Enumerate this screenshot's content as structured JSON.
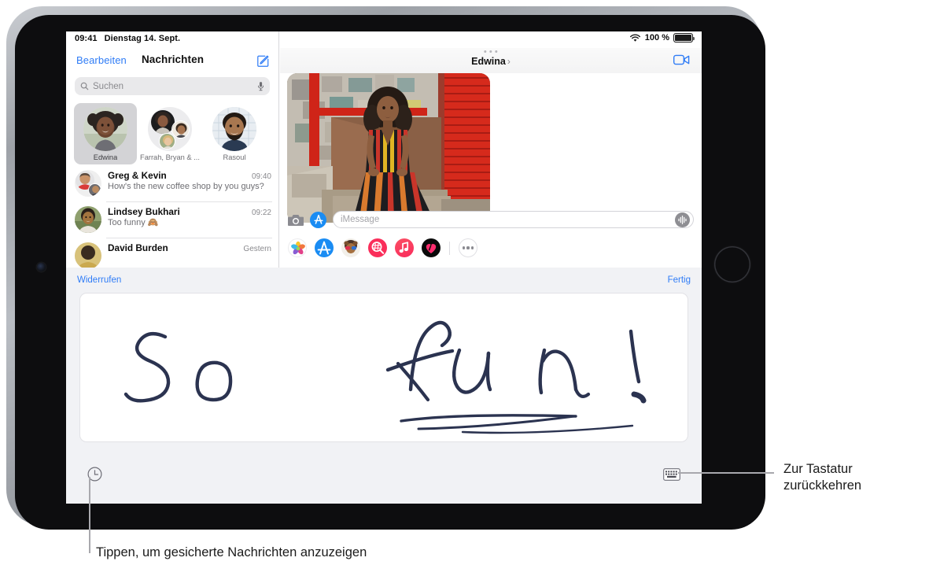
{
  "device": {
    "name": "ipad-landscape",
    "front_camera": "front-camera",
    "home_button": "home-button"
  },
  "status_bar": {
    "time": "09:41",
    "date": "Dienstag 14. Sept.",
    "wifi_icon": "wifi-icon",
    "battery_percent": "100 %",
    "battery_icon": "battery-full-icon"
  },
  "sidebar": {
    "edit_label": "Bearbeiten",
    "title": "Nachrichten",
    "compose_icon": "compose-icon",
    "search": {
      "placeholder": "Suchen",
      "search_icon": "search-icon",
      "mic_icon": "microphone-icon"
    },
    "pinned": [
      {
        "label": "Edwina",
        "selected": true
      },
      {
        "label": "Farrah, Bryan & ...",
        "selected": false
      },
      {
        "label": "Rasoul",
        "selected": false
      }
    ],
    "conversations": [
      {
        "name": "Greg & Kevin",
        "time": "09:40",
        "preview": "How's the new coffee shop by you guys?"
      },
      {
        "name": "Lindsey Bukhari",
        "time": "09:22",
        "preview": "Too funny 🙈"
      },
      {
        "name": "David Burden",
        "time": "Gestern",
        "preview": ""
      }
    ]
  },
  "thread": {
    "grabber_icon": "drag-handle-icon",
    "title": "Edwina",
    "title_chevron": "chevron-right-icon",
    "facetime_icon": "facetime-video-icon",
    "photo_alt": "photo-message",
    "input": {
      "camera_icon": "camera-icon",
      "appstore_icon": "app-store-icon",
      "placeholder": "iMessage",
      "audio_icon": "audio-waveform-icon"
    },
    "app_drawer": [
      {
        "name": "photos-app-icon",
        "color": "#ffffff"
      },
      {
        "name": "app-store-app-icon",
        "color": "#1a8cf3"
      },
      {
        "name": "memoji-app-icon",
        "color": "#f2efe9"
      },
      {
        "name": "images-app-icon",
        "color": "#fa2e5a"
      },
      {
        "name": "music-app-icon",
        "color": "#fb3b54"
      },
      {
        "name": "digital-touch-app-icon",
        "color": "#0a0a0a"
      }
    ],
    "more_apps_icon": "more-apps-icon"
  },
  "handwriting": {
    "undo_label": "Widerrufen",
    "done_label": "Fertig",
    "canvas_text": "So fun!",
    "ink_color": "#2b3350",
    "recents_icon": "clock-recents-icon",
    "keyboard_icon": "keyboard-icon"
  },
  "callouts": [
    {
      "id": "keyboard-callout",
      "text_line1": "Zur Tastatur",
      "text_line2": "zurückkehren"
    },
    {
      "id": "recents-callout",
      "text_line1": "Tippen, um gesicherte Nachrichten anzuzeigen",
      "text_line2": ""
    }
  ],
  "colors": {
    "accent_blue": "#2f7cf6",
    "panel_gray": "#f1f2f5",
    "separator": "#e2e2e5"
  }
}
